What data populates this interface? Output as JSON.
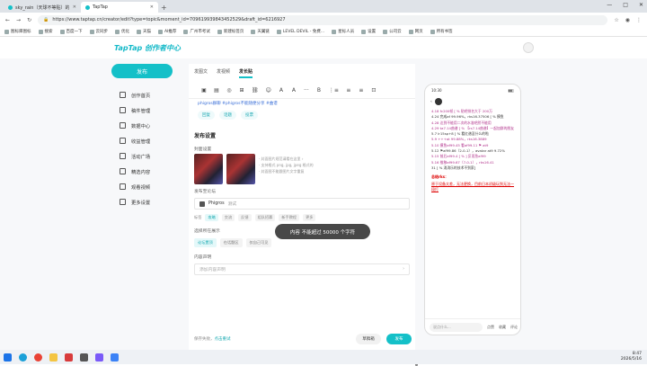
{
  "browser": {
    "tabs": [
      {
        "label": "sky_rain（天球不等贴）的个人主页 -",
        "active": false
      },
      {
        "label": "TapTap",
        "active": true
      }
    ],
    "new_tab": "+",
    "window_controls": [
      "—",
      "□",
      "✕"
    ],
    "url": "https://www.taptap.cn/creator/edit?type=topic&moment_id=709619939843452529&draft_id=6216927",
    "bookmarks": [
      "图标库图标",
      "搜索",
      "百度一下",
      "云同步",
      "优化",
      "天猫",
      "AI推荐",
      "广州市考试",
      "新建标签页",
      "天翼链",
      "LEVEL DEVIL - 免费...",
      "星标人员",
      "设置",
      "公司云",
      "网页",
      "所有书签"
    ]
  },
  "header": {
    "logo": "TapTap 创作者中心"
  },
  "sidebar": {
    "publish_label": "发布",
    "items": [
      {
        "label": "创作首页",
        "icon": "home-icon"
      },
      {
        "label": "稿件管理",
        "icon": "document-icon"
      },
      {
        "label": "数据中心",
        "icon": "chart-icon"
      },
      {
        "label": "收益管理",
        "icon": "wallet-icon"
      },
      {
        "label": "活动广场",
        "icon": "flag-icon"
      },
      {
        "label": "精选内容",
        "icon": "star-icon"
      },
      {
        "label": "观看视频",
        "icon": "video-icon"
      },
      {
        "label": "更多设置",
        "icon": "settings-icon"
      }
    ]
  },
  "editor": {
    "tabs": [
      "发图文",
      "发视频",
      "发长贴"
    ],
    "active_tab": 2,
    "toolbar": [
      "▣",
      "▤",
      "◎",
      "⊞",
      "⛓",
      "☺",
      "A",
      "A",
      "···",
      "B",
      "⋮≡",
      "≡",
      "≡",
      "⊡"
    ],
    "hashtags": "phigros群聊 #phigros不能随便分享 #曲谱",
    "chips": [
      "回复",
      "话题",
      "投票"
    ],
    "publish_settings_title": "发布设置",
    "cover_label": "封面设置",
    "cover_tips": [
      "· 封面图片规范请看在这里 ›",
      "· 支持格式 png, jpg, jpeg 格式的",
      "· 封面图不能跟图片文字重复"
    ],
    "toast": "内容 不能超过 50000 个字符",
    "forum_label": "发布至论坛",
    "forum_value": "Phigros",
    "forum_badge": "测试",
    "tags_prefix": "标签",
    "tags": [
      "攻略",
      "交流",
      "反馈",
      "组队招募",
      "新手教程",
      "更多"
    ],
    "tag_on_index": 0,
    "visibility_label": "选择所在展示",
    "visibility_options": [
      "论坛置顶",
      "在话题区",
      "仅自己可见"
    ],
    "statement_label": "内容声明",
    "statement_placeholder": "添加内容声明",
    "footer_status": "保存失败，",
    "footer_link": "点击重试",
    "draft_label": "草稿箱",
    "publish_label": "发布"
  },
  "phone_preview": {
    "time": "10:30",
    "lines": [
      "4.18 fc200帧 [ % 贴吧排名大于 200万",
      "4.24 完成af 99.96%，rks16.37506 [ % 摸鱼",
      "4.28 达到不能用二次的水准吧然不能用",
      "4.29 ta7.14曲谱 [ % 【rs7.14曲谱】一起加群的朋友",
      "5.7 lr15sp+8 [ % 看红谱没什么的啦",
      "5.9 +++at 99.88%，rks16.3889",
      "5.10 摸鱼af99.45 看af99.11 ⚑ at9",
      "5.12 ⚑af99.86（2-0-1），avatar at9 9.72%",
      "5.15 前后af99.4 [ % ] 反而急af99",
      "5.16 推移af99.67（7-0-1），rks16.41",
      "31 [ % 消消乐的技术不到家]"
    ],
    "red_line_1": "总结rks：",
    "red_line_2": "原于设备太差，无法更换，目前日本初级玩到无法一段打",
    "input_placeholder": "说点什么...",
    "actions": [
      "点赞",
      "收藏",
      "评论"
    ]
  },
  "taskbar": {
    "time": "8:47",
    "date": "2026/5/16"
  }
}
